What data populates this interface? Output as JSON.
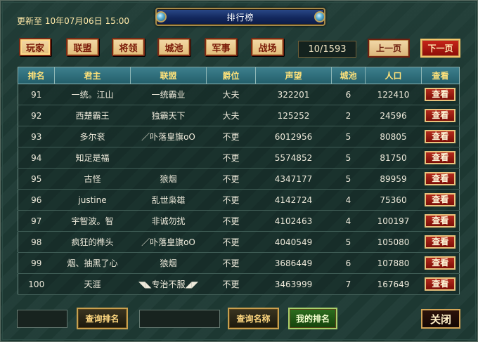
{
  "header": {
    "update_label": "更新至 10年07月06日 15:00",
    "title": "排行榜"
  },
  "tabs": [
    {
      "label": "玩家",
      "active": true
    },
    {
      "label": "联盟",
      "active": false
    },
    {
      "label": "将领",
      "active": false
    },
    {
      "label": "城池",
      "active": false
    },
    {
      "label": "军事",
      "active": false
    },
    {
      "label": "战场",
      "active": false
    }
  ],
  "pagination": {
    "indicator": "10/1593",
    "prev_label": "上一页",
    "next_label": "下一页"
  },
  "table": {
    "columns": [
      "排名",
      "君主",
      "联盟",
      "爵位",
      "声望",
      "城池",
      "人口",
      "查看"
    ],
    "rows": [
      {
        "rank": "91",
        "lord": "一统。江山",
        "alliance": "一统霸业",
        "title": "大夫",
        "prestige": "322201",
        "cities": "6",
        "population": "122410",
        "view": "查看"
      },
      {
        "rank": "92",
        "lord": "西楚霸王",
        "alliance": "独霸天下",
        "title": "大夫",
        "prestige": "125252",
        "cities": "2",
        "population": "24596",
        "view": "查看"
      },
      {
        "rank": "93",
        "lord": "多尔衮",
        "alliance": "／卟落皇旗oO",
        "title": "不更",
        "prestige": "6012956",
        "cities": "5",
        "population": "80805",
        "view": "查看"
      },
      {
        "rank": "94",
        "lord": "知足是福",
        "alliance": "",
        "title": "不更",
        "prestige": "5574852",
        "cities": "5",
        "population": "81750",
        "view": "查看"
      },
      {
        "rank": "95",
        "lord": "古怪",
        "alliance": "狼烟",
        "title": "不更",
        "prestige": "4347177",
        "cities": "5",
        "population": "89959",
        "view": "查看"
      },
      {
        "rank": "96",
        "lord": "justine",
        "alliance": "乱世枭雄",
        "title": "不更",
        "prestige": "4142724",
        "cities": "4",
        "population": "75360",
        "view": "查看"
      },
      {
        "rank": "97",
        "lord": "宇智波。智",
        "alliance": "非诚勿扰",
        "title": "不更",
        "prestige": "4102463",
        "cities": "4",
        "population": "100197",
        "view": "查看"
      },
      {
        "rank": "98",
        "lord": "疯狂的榫头",
        "alliance": "／卟落皇旗oO",
        "title": "不更",
        "prestige": "4040549",
        "cities": "5",
        "population": "105080",
        "view": "查看"
      },
      {
        "rank": "99",
        "lord": "烟、抽黑了心",
        "alliance": "狼烟",
        "title": "不更",
        "prestige": "3686449",
        "cities": "6",
        "population": "107880",
        "view": "查看"
      },
      {
        "rank": "100",
        "lord": "天涯",
        "alliance": "◥◣专治不服◢◤",
        "title": "不更",
        "prestige": "3463999",
        "cities": "7",
        "population": "167649",
        "view": "查看"
      }
    ]
  },
  "footer": {
    "search_rank_value": "",
    "search_rank_label": "查询排名",
    "search_name_value": "",
    "search_name_label": "查询名称",
    "my_rank_label": "我的排名",
    "close_label": "关闭"
  }
}
